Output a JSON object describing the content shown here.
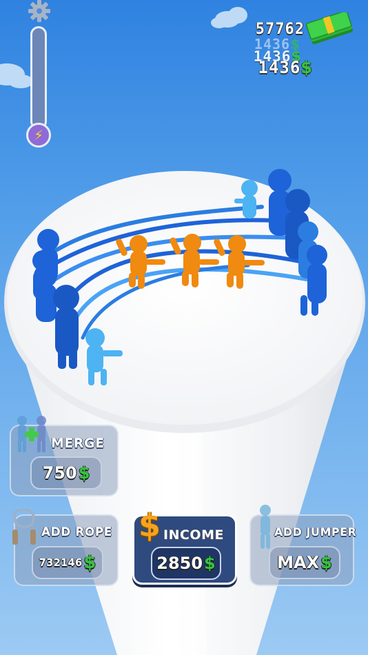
{
  "hud": {
    "settings_icon": "gear-icon",
    "energy_icon": "lightning-bolt-icon",
    "energy_level": 0.0,
    "currency_symbol": "$",
    "balance": "57762",
    "income_popups": [
      "1436",
      "1436",
      "1436"
    ]
  },
  "buttons": {
    "merge": {
      "label": "MERGE",
      "price": "750",
      "currency": "$",
      "icon": "stickmen-merge-icon",
      "state": "disabled"
    },
    "add_rope": {
      "label": "ADD ROPE",
      "price": "732146",
      "currency": "$",
      "icon": "jump-rope-icon",
      "state": "disabled"
    },
    "income": {
      "label": "INCOME",
      "price": "2850",
      "currency": "$",
      "icon": "dollar-sign-icon",
      "state": "enabled"
    },
    "add_jumper": {
      "label": "ADD JUMPER",
      "price": "MAX",
      "currency": "$",
      "icon": "jumper-figure-icon",
      "state": "disabled"
    }
  },
  "colors": {
    "sky": "#4e98e6",
    "platform": "#f7f7f9",
    "blue_team": "#1e63d8",
    "jumpers": "#f08a10",
    "money_green": "#34c63c",
    "income_button": "#2f4a7e"
  }
}
